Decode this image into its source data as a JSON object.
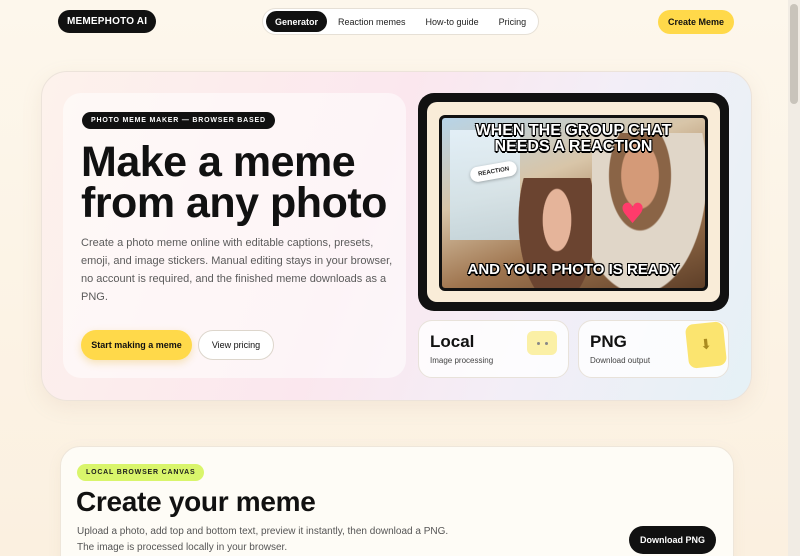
{
  "header": {
    "brand": "MEMEPHOTO AI",
    "nav": [
      "Generator",
      "Reaction memes",
      "How-to guide",
      "Pricing"
    ],
    "cta": "Create Meme"
  },
  "hero": {
    "kicker": "PHOTO MEME MAKER — BROWSER BASED",
    "title_line1": "Make a meme",
    "title_line2": "from any photo",
    "description": "Create a photo meme online with editable captions, presets, emoji, and image stickers. Manual editing stays in your browser, no account is required, and the finished meme downloads as a PNG.",
    "primary_button": "Start making a meme",
    "secondary_button": "View pricing"
  },
  "preview": {
    "top_caption_line1": "WHEN THE GROUP CHAT",
    "top_caption_line2": "NEEDS A REACTION",
    "bottom_caption": "AND YOUR PHOTO IS READY",
    "sticker_label": "REACTION",
    "heart_sticker": "heart-icon"
  },
  "stats": [
    {
      "value": "Local",
      "label": "Image processing",
      "icon": "chip-icon"
    },
    {
      "value": "PNG",
      "label": "Download output",
      "icon": "download-doc-icon"
    }
  ],
  "create": {
    "kicker": "LOCAL BROWSER CANVAS",
    "title": "Create your meme",
    "desc_line1": "Upload a photo, add top and bottom text, preview it instantly, then download a PNG.",
    "desc_line2": "The image is processed locally in your browser.",
    "download_button": "Download PNG"
  },
  "colors": {
    "accent": "#ffd94a",
    "dark": "#111111",
    "lime": "#d9f56b",
    "heart": "#ff3b6b"
  }
}
